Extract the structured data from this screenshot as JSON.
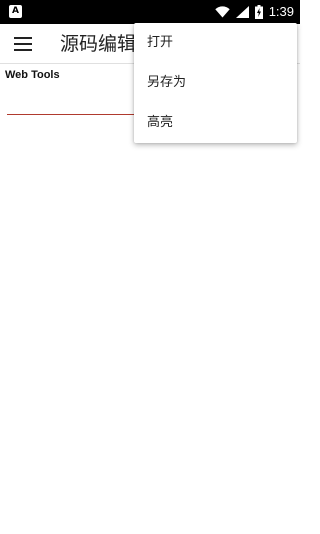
{
  "status_bar": {
    "left_icon": "notification-a-icon",
    "left_icon_text": "A",
    "icons": [
      "wifi-icon",
      "signal-icon",
      "battery-charging-icon"
    ],
    "time": "1:39"
  },
  "app_bar": {
    "menu_icon": "hamburger-menu-icon",
    "title": "源码编辑器"
  },
  "content": {
    "label": "Web Tools"
  },
  "overflow_menu": {
    "items": [
      {
        "label": "打开"
      },
      {
        "label": "另存为"
      },
      {
        "label": "高亮"
      }
    ]
  },
  "colors": {
    "status_bar": "#000000",
    "accent_underline": "#b03a2e",
    "background": "#ffffff"
  }
}
